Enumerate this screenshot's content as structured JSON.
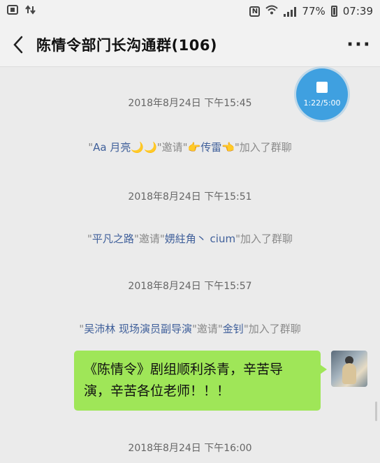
{
  "status_bar": {
    "battery": "77%",
    "time": "07:39",
    "icons": [
      "screenshot-icon",
      "data-transfer-icon",
      "nfc-icon",
      "wifi-icon",
      "signal-icon",
      "battery-icon"
    ]
  },
  "header": {
    "back_glyph": "〈",
    "title": "陈情令部门长沟通群(106)",
    "more_glyph": "···"
  },
  "recording": {
    "time": "1:22/5:00",
    "color": "#3fa0e0"
  },
  "messages": {
    "ts1": "2018年8月24日 下午15:45",
    "sys1": {
      "q1": "\"",
      "inviter": "Aa 月亮",
      "inviter_emoji": "🌙🌙",
      "q2": "\"",
      "verb": "邀请",
      "q3": "\"",
      "invitee_emoji_left": "👉",
      "invitee": "传雷",
      "invitee_emoji_right": "👈",
      "tail": "\"加入了群聊"
    },
    "ts2": "2018年8月24日 下午15:51",
    "sys2": {
      "q1": "\"",
      "inviter": "平凡之路",
      "q2": "\"",
      "verb": "邀请",
      "q3": "\"",
      "invitee": "娚紸角丶 cium",
      "tail": "\"加入了群聊"
    },
    "ts3": "2018年8月24日 下午15:57",
    "sys3": {
      "q1": "\"",
      "inviter": "吴沛林 现场演员副导演",
      "q2": "\"",
      "verb": "邀请",
      "q3": "\"",
      "invitee": "金钊",
      "tail": "\"加入了群聊"
    },
    "bubble_line1": "《陈情令》剧组顺利杀青，辛苦导",
    "bubble_line2": "演，辛苦各位老师！！！",
    "ts4": "2018年8月24日 下午16:00"
  },
  "colors": {
    "bubble": "#9fe658",
    "name_link": "#3f5f9a",
    "system_text": "#8a8a8a"
  }
}
